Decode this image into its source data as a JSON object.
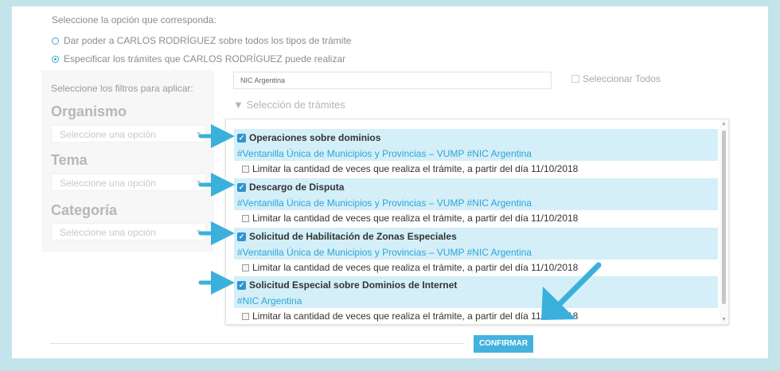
{
  "instruction": "Seleccione la opción que corresponda:",
  "options": [
    {
      "label": "Dar poder a CARLOS RODRÍGUEZ sobre todos los tipos de trámite",
      "selected": false
    },
    {
      "label": "Especificar los trámites que CARLOS RODRÍGUEZ puede realizar",
      "selected": true
    }
  ],
  "filters": {
    "hint": "Seleccione los filtros para aplicar:",
    "organismo_label": "Organismo",
    "organismo_placeholder": "Seleccione una opción",
    "tema_label": "Tema",
    "tema_placeholder": "Seleccione una opción",
    "categoria_label": "Categoría",
    "categoria_placeholder": "Seleccione una opción"
  },
  "filter_input_value": "NIC Argentina",
  "select_all_label": "Seleccionar Todos",
  "selection_title": "Selección de trámites",
  "items": [
    {
      "title": "Operaciones sobre dominios",
      "org": "#Ventanilla Única de Municipios y Provincias – VUMP #NIC Argentina",
      "limit": "Limitar la cantidad de veces que realiza el trámite, a partir del día 11/10/2018",
      "checked": true
    },
    {
      "title": "Descargo de Disputa",
      "org": "#Ventanilla Única de Municipios y Provincias – VUMP #NIC Argentina",
      "limit": "Limitar la cantidad de veces que realiza el trámite, a partir del día 11/10/2018",
      "checked": true
    },
    {
      "title": "Solicitud de Habilitación de Zonas Especiales",
      "org": "#Ventanilla Única de Municipios y Provincias – VUMP #NIC Argentina",
      "limit": "Limitar la cantidad de veces que realiza el trámite, a partir del día 11/10/2018",
      "checked": true
    },
    {
      "title": "Solicitud Especial sobre Dominios de Internet",
      "org": "#NIC Argentina",
      "limit": "Limitar la cantidad de veces que realiza el trámite, a partir del día 11/10/2018",
      "checked": true
    }
  ],
  "confirm_label": "CONFIRMAR",
  "colors": {
    "accent": "#2fa5d6",
    "band": "#d4eff8",
    "annotation_arrow": "#3bb0dc",
    "button": "#44b2de"
  }
}
